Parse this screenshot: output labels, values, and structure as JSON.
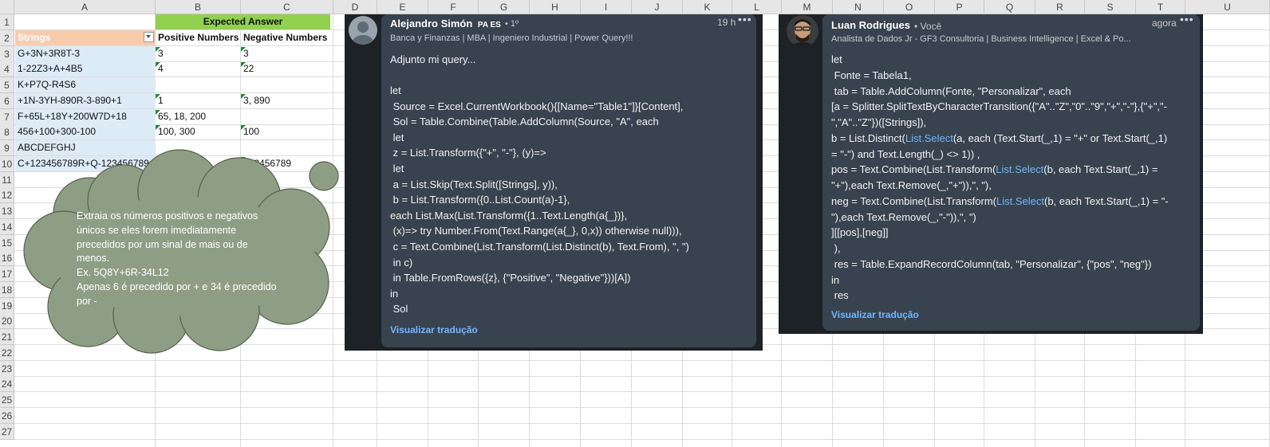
{
  "sheet": {
    "columns": [
      "A",
      "B",
      "C",
      "D",
      "E",
      "F",
      "G",
      "H",
      "I",
      "J",
      "K",
      "L",
      "M",
      "N",
      "O",
      "P",
      "Q",
      "R",
      "S",
      "T",
      "U"
    ],
    "rows": [
      "1",
      "2",
      "3",
      "4",
      "5",
      "6",
      "7",
      "8",
      "9",
      "10",
      "11",
      "12",
      "13",
      "14",
      "15",
      "16",
      "17",
      "18",
      "19",
      "20",
      "21",
      "22",
      "23",
      "24",
      "25",
      "26",
      "27"
    ],
    "expected_answer": "Expected Answer",
    "headers": {
      "strings": "Strings",
      "positive": "Positive Numbers",
      "negative": "Negative Numbers"
    },
    "data_rows": [
      {
        "a": "G+3N+3R8T-3",
        "b": "3",
        "c": "3"
      },
      {
        "a": "1-22Z3+A+4B5",
        "b": "4",
        "c": "22"
      },
      {
        "a": "K+P7Q-R4S6",
        "b": "",
        "c": ""
      },
      {
        "a": "+1N-3YH-890R-3-890+1",
        "b": "1",
        "c": "3, 890"
      },
      {
        "a": "F+65L+18Y+200W7D+18",
        "b": "65, 18, 200",
        "c": ""
      },
      {
        "a": "456+100+300-100",
        "b": "100, 300",
        "c": "100"
      },
      {
        "a": "ABCDEFGHJ",
        "b": "",
        "c": ""
      },
      {
        "a": "C+123456789R+Q-123456789",
        "b": "123456789",
        "c": "123456789"
      }
    ],
    "colors": {
      "header_fill": "#f8cbad",
      "string_fill": "#ddebf7",
      "expected_fill": "#92d050",
      "triangle": "#1e8a3a"
    }
  },
  "callout": {
    "lines": [
      "Extraia os números positivos e negativos",
      "únicos se eles forem imediatamente",
      "precedidos por um sinal de mais ou de",
      "menos.",
      "Ex. 5Q8Y+6R-34L12",
      "Apenas 6 é precedido por + e 34 é precedido",
      "por -"
    ],
    "fill": "#8e9e85"
  },
  "comment1": {
    "author": "Alejandro Simón",
    "badges": "PA ES",
    "degree": "• 1º",
    "headline": "Banca y Finanzas | MBA | Ingeniero Industrial | Power Query!!!",
    "time": "19 h",
    "menu": "•••",
    "intro": "Adjunto mi query...",
    "code": [
      "let",
      " Source = Excel.CurrentWorkbook(){[Name=\"Table1\"]}[Content],",
      " Sol = Table.Combine(Table.AddColumn(Source, \"A\", each",
      " let",
      " z = List.Transform({\"+\", \"-\"}, (y)=>",
      " let",
      " a = List.Skip(Text.Split([Strings], y)),",
      " b = List.Transform({0..List.Count(a)-1},",
      "each List.Max(List.Transform({1..Text.Length(a{_})},",
      " (x)=> try Number.From(Text.Range(a{_}, 0,x)) otherwise null))),",
      " c = Text.Combine(List.Transform(List.Distinct(b), Text.From), \", \")",
      " in c)",
      " in Table.FromRows({z}, {\"Positive\", \"Negative\"}))[A])",
      "in",
      " Sol"
    ],
    "translate": "Visualizar tradução"
  },
  "comment2": {
    "author": "Luan Rodrigues",
    "degree": "• Você",
    "headline": "Analista de Dados Jr - GF3 Consultoria | Business Intelligence | Excel & Po...",
    "time": "agora",
    "menu": "•••",
    "code": [
      {
        "pre": "let",
        "hl": "",
        "post": ""
      },
      {
        "pre": " Fonte = Tabela1,",
        "hl": "",
        "post": ""
      },
      {
        "pre": " tab = Table.AddColumn(Fonte, \"Personalizar\", each",
        "hl": "",
        "post": ""
      },
      {
        "pre": "[a = Splitter.SplitTextByCharacterTransition({\"A\"..\"Z\",\"0\"..\"9\",\"+\",\"-\"},{\"+\",\"-",
        "hl": "",
        "post": ""
      },
      {
        "pre": "\",\"A\"..\"Z\"})([Strings]),",
        "hl": "",
        "post": ""
      },
      {
        "pre": "b = List.Distinct(",
        "hl": "List.Select",
        "post": "(a, each (Text.Start(_,1) = \"+\" or Text.Start(_,1)"
      },
      {
        "pre": "= \"-\") and Text.Length(_) <> 1)) ,",
        "hl": "",
        "post": ""
      },
      {
        "pre": "pos = Text.Combine(List.Transform(",
        "hl": "List.Select",
        "post": "(b, each Text.Start(_,1) ="
      },
      {
        "pre": "\"+\"),each Text.Remove(_,\"+\")),\", \"),",
        "hl": "",
        "post": ""
      },
      {
        "pre": "neg = Text.Combine(List.Transform(",
        "hl": "List.Select",
        "post": "(b, each Text.Start(_,1) = \"-"
      },
      {
        "pre": "\"),each Text.Remove(_,\"-\")),\", \")",
        "hl": "",
        "post": ""
      },
      {
        "pre": "][[pos],[neg]]",
        "hl": "",
        "post": ""
      },
      {
        "pre": " ),",
        "hl": "",
        "post": ""
      },
      {
        "pre": " res = Table.ExpandRecordColumn(tab, \"Personalizar\", {\"pos\", \"neg\"})",
        "hl": "",
        "post": ""
      },
      {
        "pre": "in",
        "hl": "",
        "post": ""
      },
      {
        "pre": " res",
        "hl": "",
        "post": ""
      }
    ],
    "translate": "Visualizar tradução"
  }
}
